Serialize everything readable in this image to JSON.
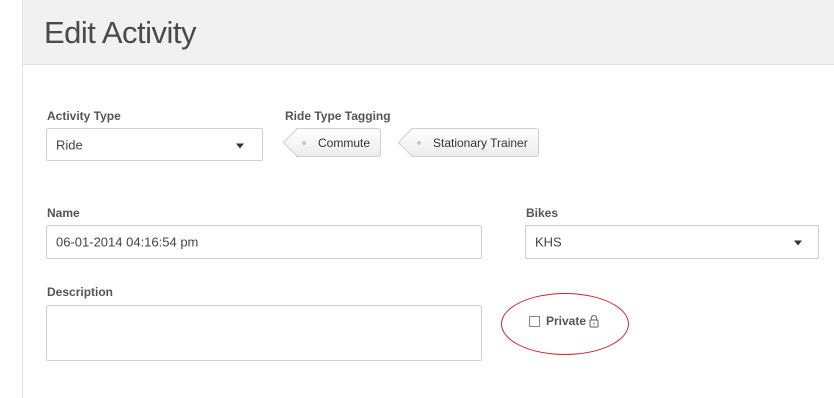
{
  "header": {
    "title": "Edit Activity"
  },
  "activity_type": {
    "label": "Activity Type",
    "value": "Ride"
  },
  "ride_type_tagging": {
    "label": "Ride Type Tagging",
    "tags": [
      {
        "label": "Commute"
      },
      {
        "label": "Stationary Trainer"
      }
    ]
  },
  "name": {
    "label": "Name",
    "value": "06-01-2014 04:16:54 pm"
  },
  "bikes": {
    "label": "Bikes",
    "value": "KHS"
  },
  "description": {
    "label": "Description",
    "value": ""
  },
  "private": {
    "label": "Private",
    "checked": false,
    "icon": "lock-icon"
  },
  "colors": {
    "highlight": "#d2232a",
    "header_bg": "#f1f1f1"
  }
}
